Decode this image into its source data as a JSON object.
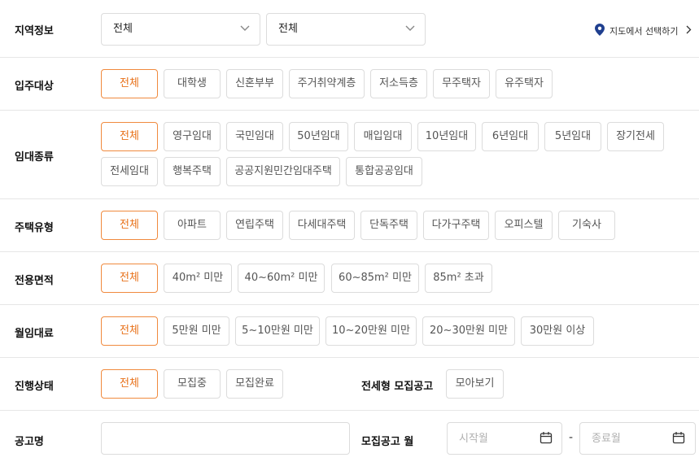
{
  "region": {
    "label": "지역정보",
    "select1": "전체",
    "select2": "전체",
    "map_link": "지도에서 선택하기"
  },
  "target": {
    "label": "입주대상",
    "options": [
      "전체",
      "대학생",
      "신혼부부",
      "주거취약계층",
      "저소득층",
      "무주택자",
      "유주택자"
    ]
  },
  "lease_type": {
    "label": "임대종류",
    "options": [
      "전체",
      "영구임대",
      "국민임대",
      "50년임대",
      "매입임대",
      "10년임대",
      "6년임대",
      "5년임대",
      "장기전세",
      "전세임대",
      "행복주택",
      "공공지원민간임대주택",
      "통합공공임대"
    ]
  },
  "house_type": {
    "label": "주택유형",
    "options": [
      "전체",
      "아파트",
      "연립주택",
      "다세대주택",
      "단독주택",
      "다가구주택",
      "오피스텔",
      "기숙사"
    ]
  },
  "area": {
    "label": "전용면적",
    "options": [
      "전체",
      "40m² 미만",
      "40~60m² 미만",
      "60~85m² 미만",
      "85m² 초과"
    ]
  },
  "rent": {
    "label": "월임대료",
    "options": [
      "전체",
      "5만원 미만",
      "5~10만원 미만",
      "10~20만원 미만",
      "20~30만원 미만",
      "30만원 이상"
    ]
  },
  "status": {
    "label": "진행상태",
    "options": [
      "전체",
      "모집중",
      "모집완료"
    ],
    "jeonse_label": "전세형 모집공고",
    "jeonse_button": "모아보기"
  },
  "notice": {
    "label": "공고명",
    "name_value": "",
    "month_label": "모집공고 월",
    "start_placeholder": "시작월",
    "end_placeholder": "종료월",
    "separator": "-"
  },
  "colors": {
    "accent": "#e8711a",
    "accent_border": "#f08a3e",
    "border": "#dcdcdc",
    "map_pin": "#1f3f8f"
  }
}
